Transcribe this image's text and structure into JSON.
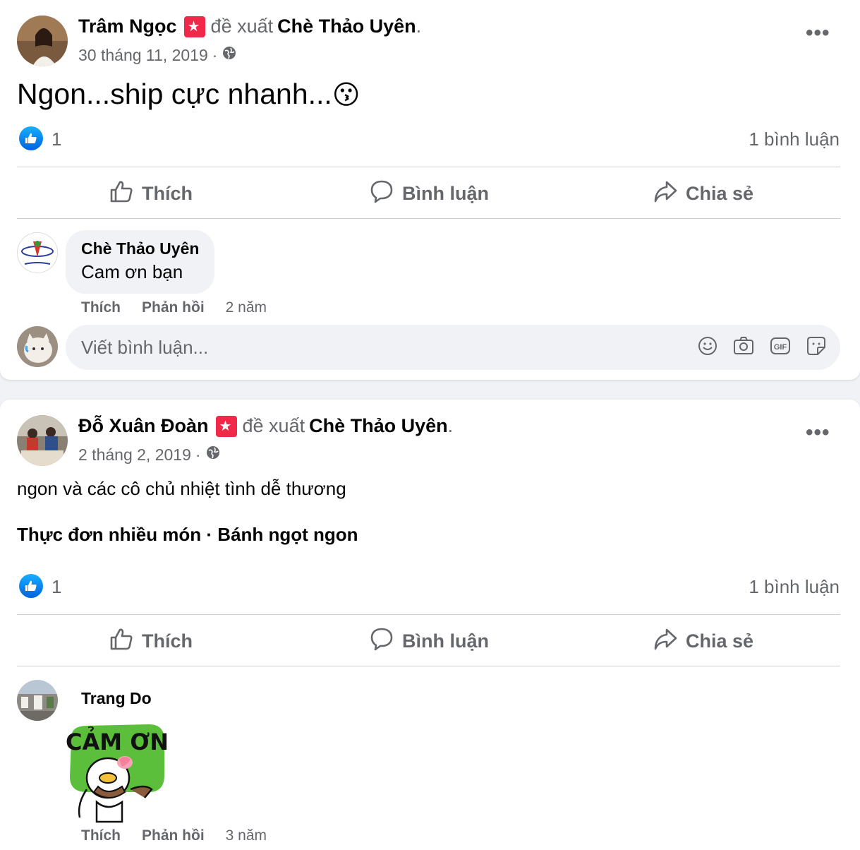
{
  "posts": [
    {
      "author": "Trâm Ngọc",
      "verb": "đề xuất",
      "page": "Chè Thảo Uyên",
      "end_dot": ".",
      "date": "30 tháng 11, 2019",
      "meta_sep": "·",
      "text": "Ngon...ship cực nhanh...",
      "emoji": "😗",
      "like_count": "1",
      "comment_count": "1 bình luận",
      "actions": {
        "like": "Thích",
        "comment": "Bình luận",
        "share": "Chia sẻ"
      },
      "comment": {
        "author": "Chè Thảo Uyên",
        "text": "Cam ơn bạn",
        "like": "Thích",
        "reply": "Phản hồi",
        "time": "2 năm"
      },
      "write_placeholder": "Viết bình luận..."
    },
    {
      "author": "Đỗ Xuân Đoàn",
      "verb": "đề xuất",
      "page": "Chè Thảo Uyên",
      "end_dot": ".",
      "date": "2 tháng 2, 2019",
      "meta_sep": "·",
      "text": "ngon và các cô chủ nhiệt tình dễ thương",
      "tags": "Thực đơn nhiều món · Bánh ngọt ngon",
      "like_count": "1",
      "comment_count": "1 bình luận",
      "actions": {
        "like": "Thích",
        "comment": "Bình luận",
        "share": "Chia sẻ"
      },
      "comment": {
        "author": "Trang Do",
        "sticker_text": "CẢM ƠN",
        "like": "Thích",
        "reply": "Phản hồi",
        "time": "3 năm"
      }
    }
  ],
  "icons": {
    "recommend": "recommend-star-icon",
    "privacy": "globe-icon",
    "more": "more-options-icon",
    "reaction": "like-reaction-icon",
    "like": "thumbs-up-icon",
    "comment": "speech-bubble-icon",
    "share": "share-arrow-icon",
    "emoji": "emoji-icon",
    "camera": "camera-icon",
    "gif": "gif-icon",
    "sticker": "sticker-icon"
  },
  "colors": {
    "recommend_badge": "#f02849",
    "like_blue": "#0866ff",
    "secondary_text": "#65676b",
    "bubble_bg": "#f0f2f5"
  }
}
